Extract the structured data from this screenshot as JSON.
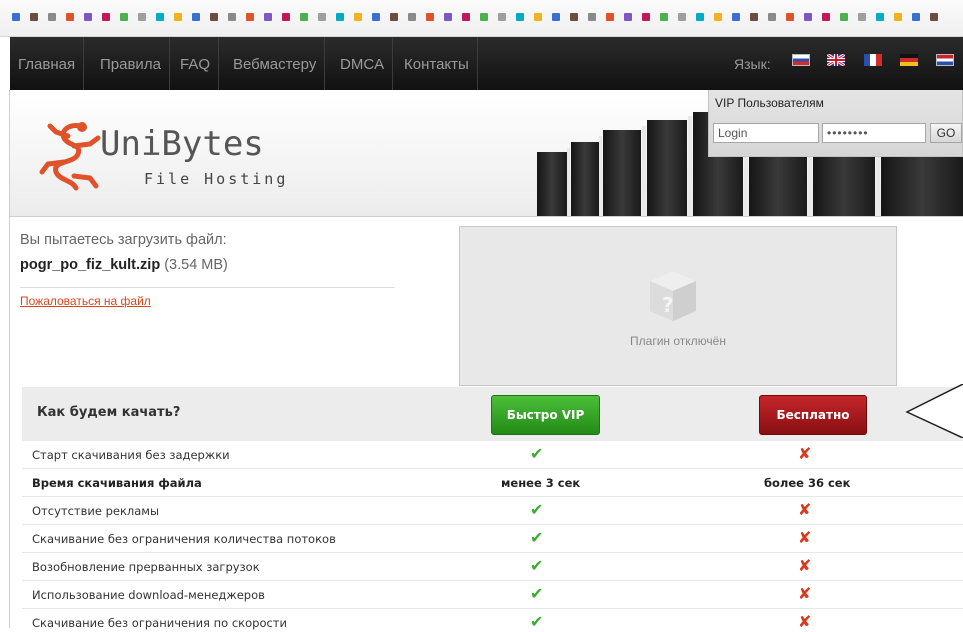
{
  "nav": {
    "items": [
      "Главная",
      "Правила",
      "FAQ",
      "Вебмастеру",
      "DMCA",
      "Контакты"
    ],
    "language_label": "Язык:",
    "flags": [
      "russian-flag",
      "uk-flag",
      "french-flag",
      "german-flag",
      "dutch-flag"
    ]
  },
  "logo": {
    "name": "UniBytes",
    "tagline": "File Hosting"
  },
  "vip_login": {
    "title": "VIP Пользователям",
    "login_value": "Login",
    "password_value": "••••••••",
    "go_label": "GO"
  },
  "file": {
    "intro": "Вы пытаетесь загрузить файл:",
    "name": "pogr_po_fiz_kult.zip",
    "size": "(3.54 MB)",
    "complain_link": "Пожаловаться на файл"
  },
  "plugin": {
    "message": "Плагин отключён"
  },
  "download": {
    "question": "Как будем качать?",
    "vip_button": "Быстро VIP",
    "free_button": "Бесплатно"
  },
  "features": [
    {
      "name": "Старт скачивания без задержки",
      "vip": "check",
      "free": "cross"
    },
    {
      "name": "Время скачивания файла",
      "vip": "менее 3 сек",
      "free": "более 36 сек",
      "bold": true
    },
    {
      "name": "Отсутствие рекламы",
      "vip": "check",
      "free": "cross"
    },
    {
      "name": "Скачивание без ограничения количества потоков",
      "vip": "check",
      "free": "cross"
    },
    {
      "name": "Возобновление прерванных загрузок",
      "vip": "check",
      "free": "cross"
    },
    {
      "name": "Использование download-менеджеров",
      "vip": "check",
      "free": "cross"
    },
    {
      "name": "Скачивание без ограничения по скорости",
      "vip": "check",
      "free": "cross"
    }
  ],
  "colors": {
    "nav_bg": "#1c1c1c",
    "logo_orange": "#e0522a",
    "vip_green": "#2e9a1e",
    "free_red": "#9b1416",
    "link_orange": "#d9481c"
  }
}
